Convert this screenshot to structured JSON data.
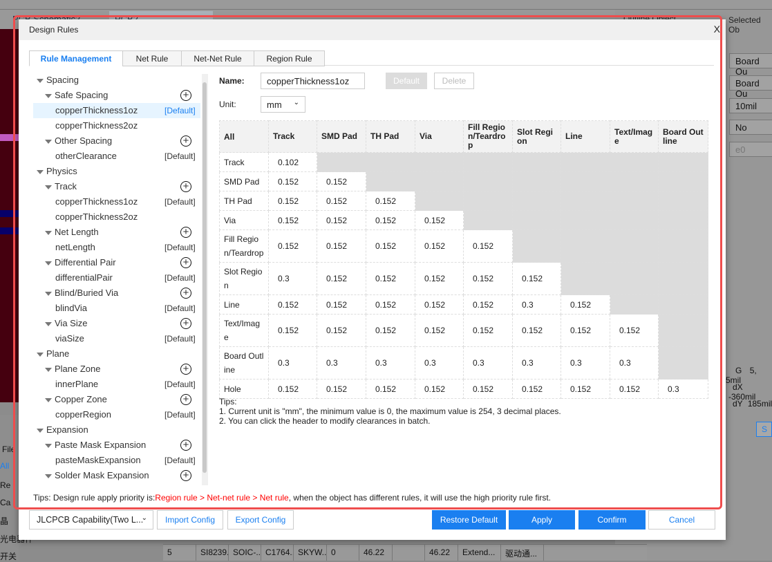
{
  "background": {
    "doc_tabs": [
      "PCB Schematic2",
      "PCB2"
    ],
    "right_panel": {
      "header_left": "Outline Object",
      "header_right": "Selected Ob",
      "fields": [
        "Board Ou",
        "Board Ou",
        "10mil",
        "No",
        "e0"
      ],
      "stats": [
        {
          "k": "G",
          "v": "5, 5mil"
        },
        {
          "k": "dX",
          "v": "-360mil"
        },
        {
          "k": "dY",
          "v": "185mil"
        }
      ],
      "s_button": "S"
    },
    "left_panel": {
      "items": [
        "Re",
        "Ca",
        "晶",
        "光电器件",
        "开关"
      ],
      "filter": "File",
      "all": "All"
    },
    "bottom_row": [
      "5",
      "SI8239...",
      "SOIC-...",
      "C1764...",
      "SKYW...",
      "0",
      "46.22",
      "",
      "46.22",
      "Extend...",
      "驱动通..."
    ]
  },
  "dialog": {
    "title": "Design Rules",
    "close": "X",
    "tabs": [
      "Rule Management",
      "Net Rule",
      "Net-Net Rule",
      "Region Rule"
    ],
    "tree": [
      {
        "label": "Spacing",
        "level": 0
      },
      {
        "label": "Safe Spacing",
        "level": 1,
        "add": true
      },
      {
        "label": "copperThickness1oz",
        "level": 2,
        "tag": "[Default]",
        "selected": true
      },
      {
        "label": "copperThickness2oz",
        "level": 2
      },
      {
        "label": "Other Spacing",
        "level": 1,
        "add": true
      },
      {
        "label": "otherClearance",
        "level": 2,
        "tag": "[Default]"
      },
      {
        "label": "Physics",
        "level": 0
      },
      {
        "label": "Track",
        "level": 1,
        "add": true
      },
      {
        "label": "copperThickness1oz",
        "level": 2,
        "tag": "[Default]"
      },
      {
        "label": "copperThickness2oz",
        "level": 2
      },
      {
        "label": "Net Length",
        "level": 1,
        "add": true
      },
      {
        "label": "netLength",
        "level": 2,
        "tag": "[Default]"
      },
      {
        "label": "Differential Pair",
        "level": 1,
        "add": true
      },
      {
        "label": "differentialPair",
        "level": 2,
        "tag": "[Default]"
      },
      {
        "label": "Blind/Buried Via",
        "level": 1,
        "add": true
      },
      {
        "label": "blindVia",
        "level": 2,
        "tag": "[Default]"
      },
      {
        "label": "Via Size",
        "level": 1,
        "add": true
      },
      {
        "label": "viaSize",
        "level": 2,
        "tag": "[Default]"
      },
      {
        "label": "Plane",
        "level": 0
      },
      {
        "label": "Plane Zone",
        "level": 1,
        "add": true
      },
      {
        "label": "innerPlane",
        "level": 2,
        "tag": "[Default]"
      },
      {
        "label": "Copper Zone",
        "level": 1,
        "add": true
      },
      {
        "label": "copperRegion",
        "level": 2,
        "tag": "[Default]"
      },
      {
        "label": "Expansion",
        "level": 0
      },
      {
        "label": "Paste Mask Expansion",
        "level": 1,
        "add": true
      },
      {
        "label": "pasteMaskExpansion",
        "level": 2,
        "tag": "[Default]"
      },
      {
        "label": "Solder Mask Expansion",
        "level": 1,
        "add": true
      }
    ],
    "name_label": "Name:",
    "name_value": "copperThickness1oz",
    "default_btn": "Default",
    "delete_btn": "Delete",
    "unit_label": "Unit:",
    "unit_value": "mm",
    "table": {
      "corner": "All",
      "columns": [
        "Track",
        "SMD Pad",
        "TH Pad",
        "Via",
        "Fill Region/Teardrop",
        "Slot Region",
        "Line",
        "Text/Image",
        "Board Outline"
      ],
      "rows": [
        {
          "h": "Track",
          "v": [
            "0.102"
          ]
        },
        {
          "h": "SMD Pad",
          "v": [
            "0.152",
            "0.152"
          ]
        },
        {
          "h": "TH Pad",
          "v": [
            "0.152",
            "0.152",
            "0.152"
          ]
        },
        {
          "h": "Via",
          "v": [
            "0.152",
            "0.152",
            "0.152",
            "0.152"
          ]
        },
        {
          "h": "Fill Region/Teardrop",
          "v": [
            "0.152",
            "0.152",
            "0.152",
            "0.152",
            "0.152"
          ]
        },
        {
          "h": "Slot Region",
          "v": [
            "0.3",
            "0.152",
            "0.152",
            "0.152",
            "0.152",
            "0.152"
          ]
        },
        {
          "h": "Line",
          "v": [
            "0.152",
            "0.152",
            "0.152",
            "0.152",
            "0.152",
            "0.3",
            "0.152"
          ]
        },
        {
          "h": "Text/Image",
          "v": [
            "0.152",
            "0.152",
            "0.152",
            "0.152",
            "0.152",
            "0.152",
            "0.152",
            "0.152"
          ]
        },
        {
          "h": "Board Outline",
          "v": [
            "0.3",
            "0.3",
            "0.3",
            "0.3",
            "0.3",
            "0.3",
            "0.3",
            "0.3"
          ]
        },
        {
          "h": "Hole",
          "v": [
            "0.152",
            "0.152",
            "0.152",
            "0.152",
            "0.152",
            "0.152",
            "0.152",
            "0.152",
            "0.3"
          ]
        }
      ]
    },
    "tips": [
      "Tips:",
      "1. Current unit is \"mm\", the minimum value is 0, the maximum value is 254, 3 decimal places.",
      "2. You can click the header to modify clearances in batch."
    ],
    "priority": {
      "prefix": "Tips: Design rule apply priority is:",
      "highlight": "Region rule > Net-net rule > Net rule",
      "suffix": ", when the object has different rules, it will use the high priority rule first."
    },
    "footer": {
      "capability": "JLCPCB Capability(Two L...",
      "import": "Import Config",
      "export": "Export Config",
      "restore": "Restore Default",
      "apply": "Apply",
      "confirm": "Confirm",
      "cancel": "Cancel"
    },
    "colors": {
      "accent": "#1a7ff0",
      "highlight": "#ff0000",
      "annotation": "#ef4d4d"
    }
  }
}
